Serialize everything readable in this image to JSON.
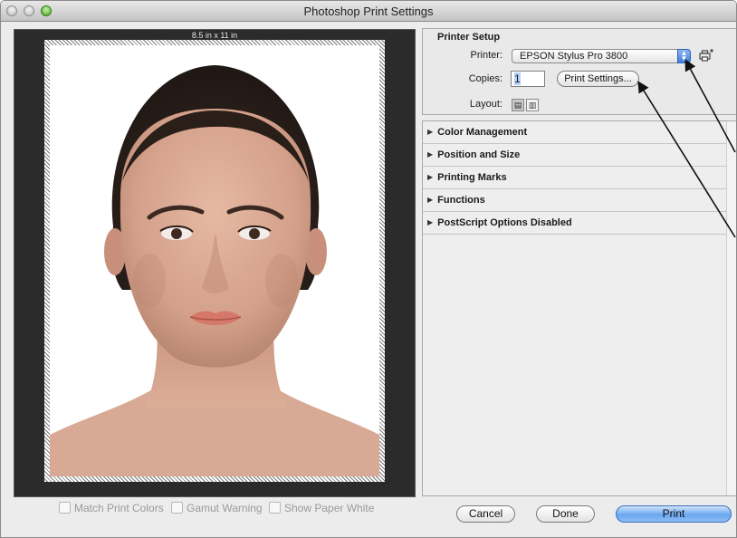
{
  "window": {
    "title": "Photoshop Print Settings"
  },
  "preview": {
    "paper_size": "8.5 in x 11 in"
  },
  "preview_checks": [
    {
      "label": "Match Print Colors",
      "checked": false
    },
    {
      "label": "Gamut Warning",
      "checked": false
    },
    {
      "label": "Show Paper White",
      "checked": false
    }
  ],
  "printer_setup": {
    "title": "Printer Setup",
    "printer_label": "Printer:",
    "printer_value": "EPSON Stylus Pro 3800",
    "copies_label": "Copies:",
    "copies_value": "1",
    "print_settings_button": "Print Settings...",
    "layout_label": "Layout:",
    "layout_options": [
      "portrait",
      "landscape"
    ],
    "layout_selected": "portrait"
  },
  "sections": [
    {
      "label": "Color Management"
    },
    {
      "label": "Position and Size"
    },
    {
      "label": "Printing Marks"
    },
    {
      "label": "Functions"
    },
    {
      "label": "PostScript Options Disabled"
    }
  ],
  "buttons": {
    "cancel": "Cancel",
    "done": "Done",
    "print": "Print"
  },
  "colors": {
    "accent": "#5a9cf0",
    "preview_background": "#2b2b2b"
  },
  "icons": [
    "printer-add-icon",
    "disclosure-triangle-icon",
    "portrait-layout-icon",
    "landscape-layout-icon"
  ]
}
